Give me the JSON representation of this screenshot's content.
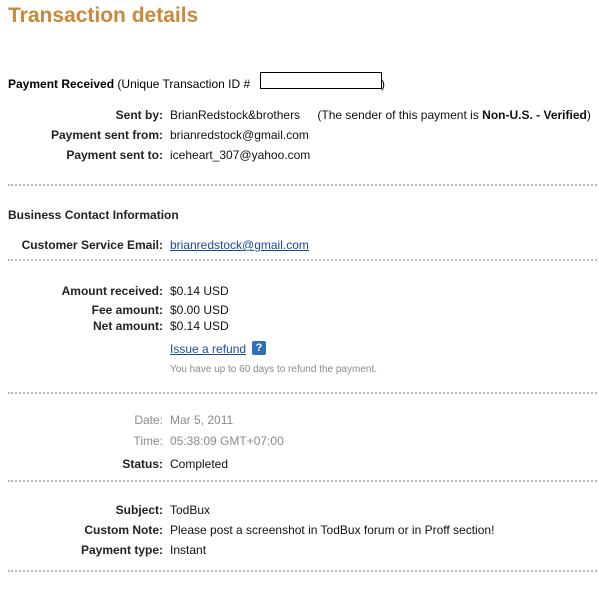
{
  "page_title": "Transaction details",
  "payment": {
    "heading": "Payment Received",
    "id_prefix": "(Unique Transaction ID #",
    "id_suffix": ")",
    "sent_by_label": "Sent by:",
    "sent_by_value": "BrianRedstock&brothers",
    "sender_note_prefix": "(The sender of this payment is",
    "sender_note_status": "Non-U.S. - Verified",
    "sender_note_suffix": ")",
    "sent_from_label": "Payment sent from:",
    "sent_from_value": "brianredstock@gmail.com",
    "sent_to_label": "Payment sent to:",
    "sent_to_value": "iceheart_307@yahoo.com"
  },
  "business": {
    "heading": "Business Contact Information",
    "cs_email_label": "Customer Service Email:",
    "cs_email_value": "brianredstock@gmail.com"
  },
  "amounts": {
    "received_label": "Amount received:",
    "received_value": "$0.14 USD",
    "fee_label": "Fee amount:",
    "fee_value": "$0.00 USD",
    "net_label": "Net amount:",
    "net_value": "$0.14 USD",
    "refund_link": "Issue a refund",
    "help_icon": "?",
    "refund_note": "You have up to 60 days to refund the payment."
  },
  "timing": {
    "date_label": "Date:",
    "date_value": "Mar 5, 2011",
    "time_label": "Time:",
    "time_value": "05:38:09 GMT+07:00",
    "status_label": "Status:",
    "status_value": "Completed"
  },
  "details": {
    "subject_label": "Subject:",
    "subject_value": "TodBux",
    "note_label": "Custom Note:",
    "note_value": "Please post a screenshot in TodBux forum or in Proff section!",
    "type_label": "Payment type:",
    "type_value": "Instant"
  },
  "colors": {
    "title": "#c9883a",
    "link": "#1a4a9c",
    "muted": "#8a8a8a",
    "help_icon_bg": "#2f6fb7"
  }
}
